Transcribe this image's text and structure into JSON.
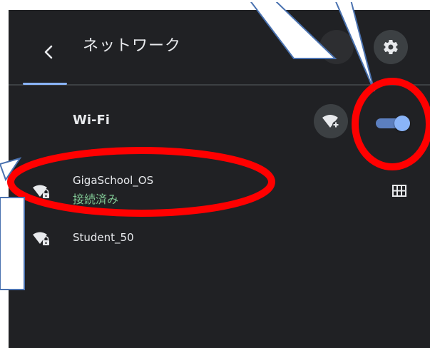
{
  "header": {
    "title": "ネットワーク",
    "back_icon": "chevron-left-icon",
    "settings_icon": "gear-icon"
  },
  "wifi": {
    "heading": "Wi-Fi",
    "add_network_icon": "wifi-add-icon",
    "enabled": true
  },
  "networks": [
    {
      "name": "GigaSchool_OS",
      "status": "接続済み",
      "icon": "wifi-locked-icon",
      "connected": true
    },
    {
      "name": "Student_50",
      "status": "",
      "icon": "wifi-locked-icon",
      "connected": false
    }
  ],
  "extra_icon": "grid-icon",
  "colors": {
    "panel": "#202124",
    "accent": "#8ab4f8",
    "connected": "#81c995",
    "annotation_red": "#ff0000",
    "callout_border": "#4a72b0"
  }
}
